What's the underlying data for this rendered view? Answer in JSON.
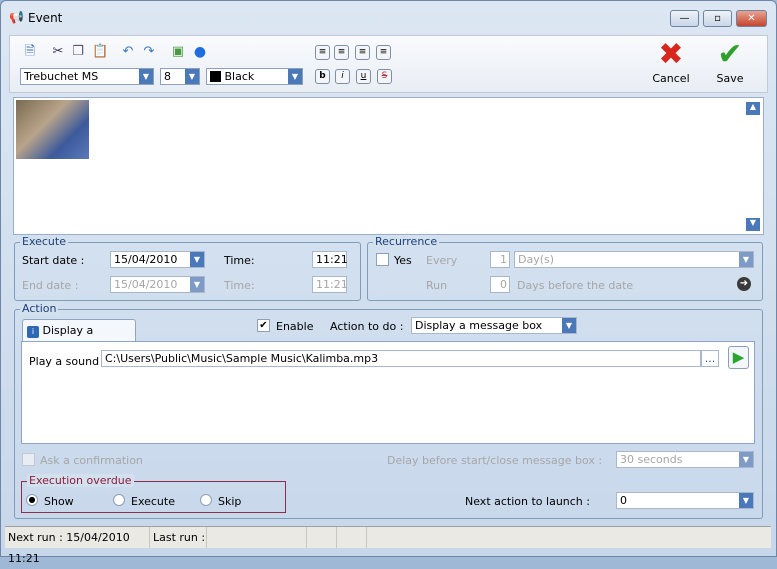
{
  "window": {
    "title": "Event",
    "minimize": "—",
    "maximize": "▫",
    "close": "✕"
  },
  "toolbar": {
    "font": "Trebuchet MS",
    "size": "8",
    "color_name": "Black",
    "color_value": "#000000",
    "bold": "b",
    "italic": "i",
    "underline": "u",
    "strike": "S",
    "cancel": "Cancel",
    "save": "Save"
  },
  "execute": {
    "legend": "Execute",
    "start_label": "Start date :",
    "start_date": "15/04/2010",
    "time_label": "Time:",
    "start_time": "11:21",
    "end_label": "End date :",
    "end_date": "15/04/2010",
    "end_time": "11:21"
  },
  "recurrence": {
    "legend": "Recurrence",
    "yes": "Yes",
    "every": "Every",
    "every_value": "1",
    "unit": "Day(s)",
    "run": "Run",
    "run_value": "0",
    "days_before": "Days before the date"
  },
  "action": {
    "legend": "Action",
    "tab": "Display a message",
    "enable": "Enable",
    "action_label": "Action to do :",
    "action_value": "Display a message box",
    "sound_label": "Play a sound :",
    "sound_path": "C:\\Users\\Public\\Music\\Sample Music\\Kalimba.mp3",
    "browse": "...",
    "confirm": "Ask a confirmation",
    "delay_label": "Delay before start/close message box :",
    "delay_value": "30 seconds",
    "next_label": "Next action to launch :",
    "next_value": "0"
  },
  "overdue": {
    "legend": "Execution overdue",
    "show": "Show",
    "execute": "Execute",
    "skip": "Skip",
    "selected": "Show"
  },
  "status": {
    "next_run": "Next run : 15/04/2010 11:21",
    "last_run": "Last run :"
  }
}
